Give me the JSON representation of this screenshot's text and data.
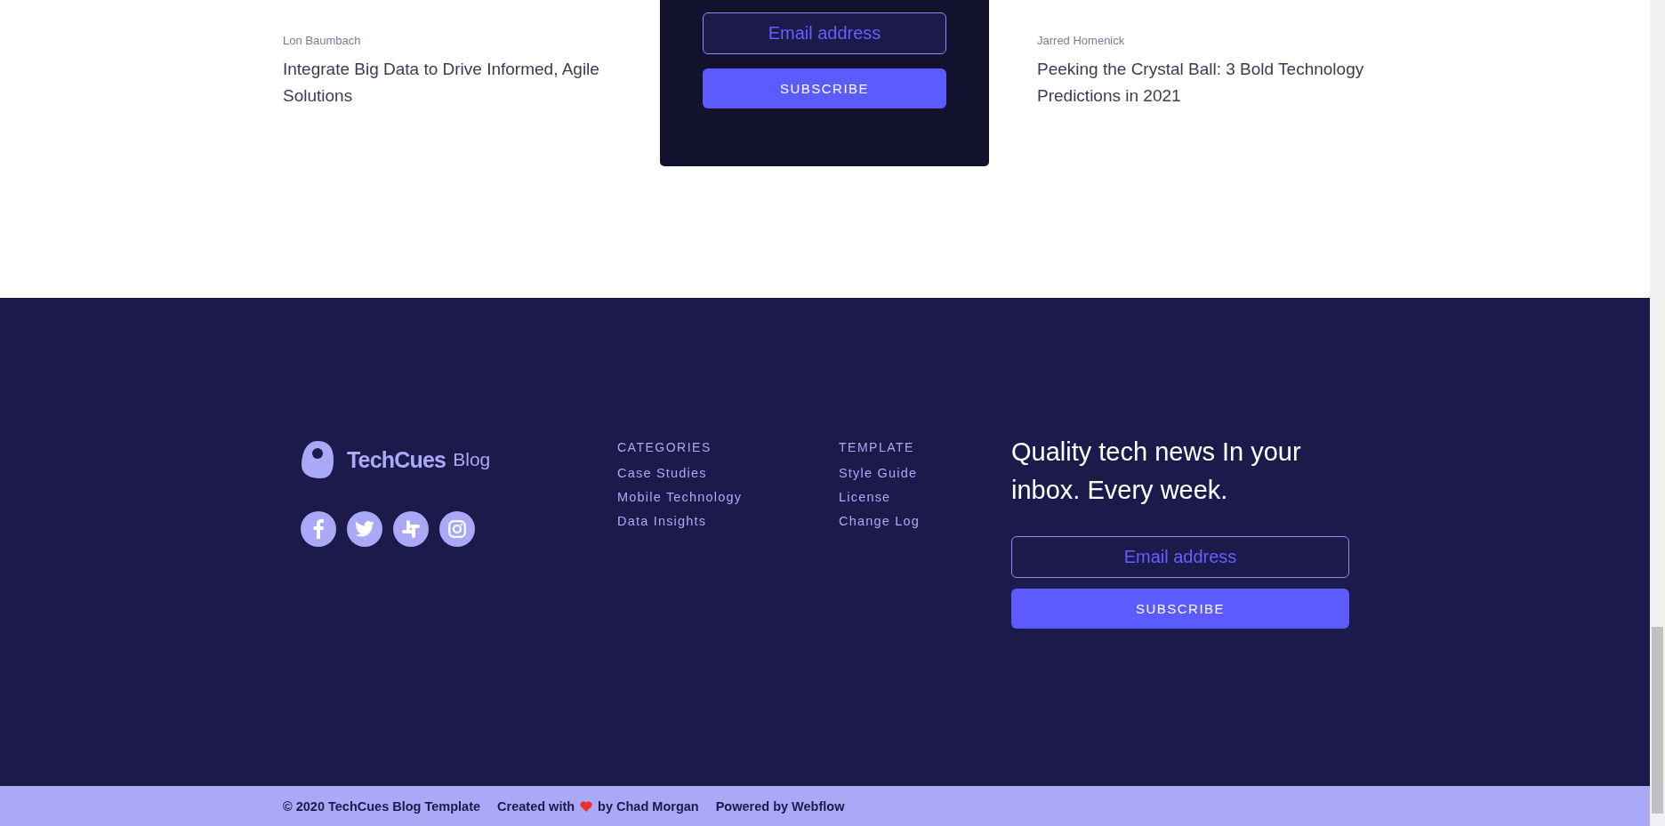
{
  "articles": [
    {
      "author": "Lon Baumbach",
      "title": "Integrate Big Data to Drive Informed, Agile Solutions"
    },
    {
      "author": "Jarred Homenick",
      "title": "Peeking the Crystal Ball: 3 Bold Technology Predictions in 2021"
    }
  ],
  "subscribe_card": {
    "email_placeholder": "Email address",
    "button": "SUBSCRIBE"
  },
  "footer": {
    "logo": {
      "name": "TechCues",
      "suffix": "Blog"
    },
    "social": [
      {
        "kind": "facebook"
      },
      {
        "kind": "twitter"
      },
      {
        "kind": "slack"
      },
      {
        "kind": "instagram"
      }
    ],
    "columns": [
      {
        "heading": "CATEGORIES",
        "links": [
          "Case Studies",
          "Mobile Technology",
          "Data Insights"
        ]
      },
      {
        "heading": "TEMPLATE",
        "links": [
          "Style Guide",
          "License",
          "Change Log"
        ]
      }
    ],
    "newsletter": {
      "heading": "Quality tech news In your inbox. Every week.",
      "email_placeholder": "Email address",
      "button": "SUBSCRIBE"
    }
  },
  "bottom_bar": {
    "copyright": "© 2020 TechCues Blog Template",
    "created_with": "Created with",
    "by": "by Chad Morgan",
    "powered_by": "Powered by Webflow"
  }
}
